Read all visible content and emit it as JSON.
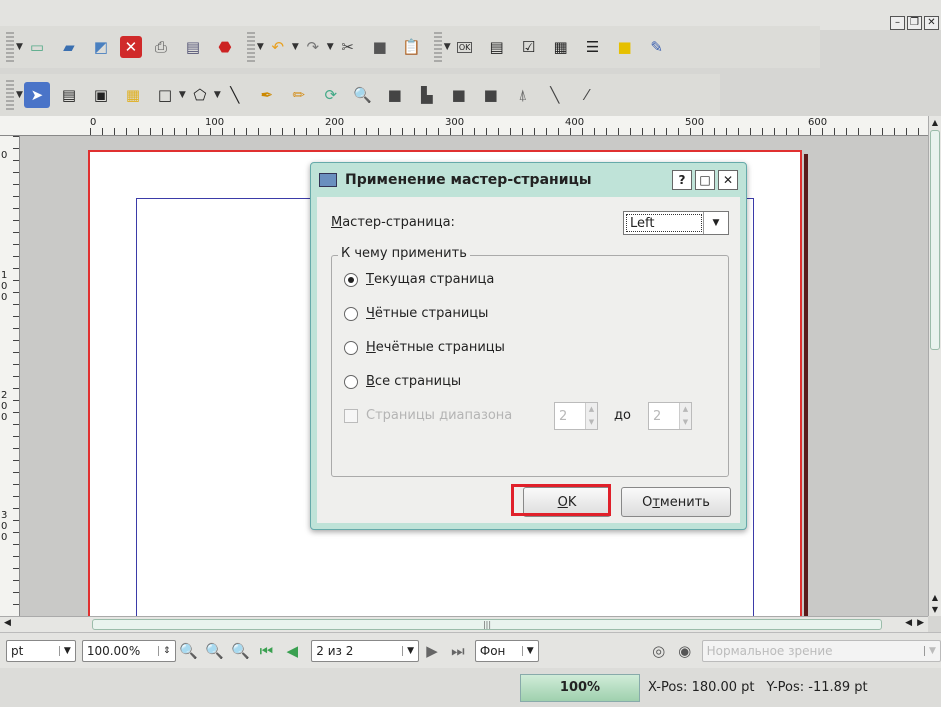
{
  "toolbar1": {
    "icons": [
      "new-document-icon",
      "open-folder-icon",
      "open-recent-icon",
      "close-document-icon",
      "print-icon",
      "preflight-icon",
      "export-pdf-icon",
      "undo-icon",
      "redo-icon",
      "cut-icon",
      "copy-icon",
      "paste-icon",
      "button-icon",
      "text-field-icon",
      "checkbox-icon",
      "combobox-icon",
      "listbox-icon",
      "text-annotation-icon",
      "link-annotation-icon"
    ],
    "button_label": "OK"
  },
  "toolbar2": {
    "icons": [
      "select-icon",
      "text-frame-icon",
      "image-frame-icon",
      "table-icon",
      "shape-icon",
      "polygon-icon",
      "line-icon",
      "bezier-icon",
      "freehand-icon",
      "rotate-icon",
      "zoom-icon",
      "edit-contents-icon",
      "edit-text-icon",
      "link-frames-icon",
      "unlink-frames-icon",
      "measure-icon",
      "copy-properties-icon",
      "eyedropper-icon"
    ]
  },
  "ruler": {
    "h_labels": [
      "0",
      "100",
      "200",
      "300",
      "400",
      "500",
      "600"
    ],
    "v_labels": [
      "0",
      "100",
      "200",
      "300"
    ]
  },
  "statusbar": {
    "unit": "pt",
    "zoom": "100.00%",
    "page": "2 из 2",
    "layer": "Фон",
    "view_mode": "Нормальное зрение",
    "progress": "100%",
    "xpos": "X-Pos: 180.00 pt",
    "ypos": "Y-Pos: -11.89 pt"
  },
  "dialog": {
    "title": "Применение мастер-страницы",
    "help": "?",
    "max": "□",
    "close": "✕",
    "master_label": "астер-страница:",
    "master_label_accel": "М",
    "master_value": "Left",
    "group_title": "К чему применить",
    "options": [
      {
        "accel": "Т",
        "rest": "екущая страница",
        "checked": true
      },
      {
        "accel": "Ч",
        "rest": "ётные страницы",
        "checked": false
      },
      {
        "accel": "Н",
        "rest": "ечётные страницы",
        "checked": false
      },
      {
        "accel": "В",
        "rest": "се страницы",
        "checked": false
      }
    ],
    "range_label_a": "Страницы ",
    "range_label_accel": "д",
    "range_label_b": "иапазона",
    "range_from": "2",
    "range_to_label": "до",
    "range_to": "2",
    "ok_accel": "O",
    "ok_rest": "K",
    "cancel_a": "О",
    "cancel_accel": "т",
    "cancel_b": "менить"
  },
  "colors": {
    "dialog_frame": "#bfe3d8",
    "page_border": "#e03030",
    "ok_highlight": "#e0202a",
    "margin_guide": "#3b3ba8"
  }
}
